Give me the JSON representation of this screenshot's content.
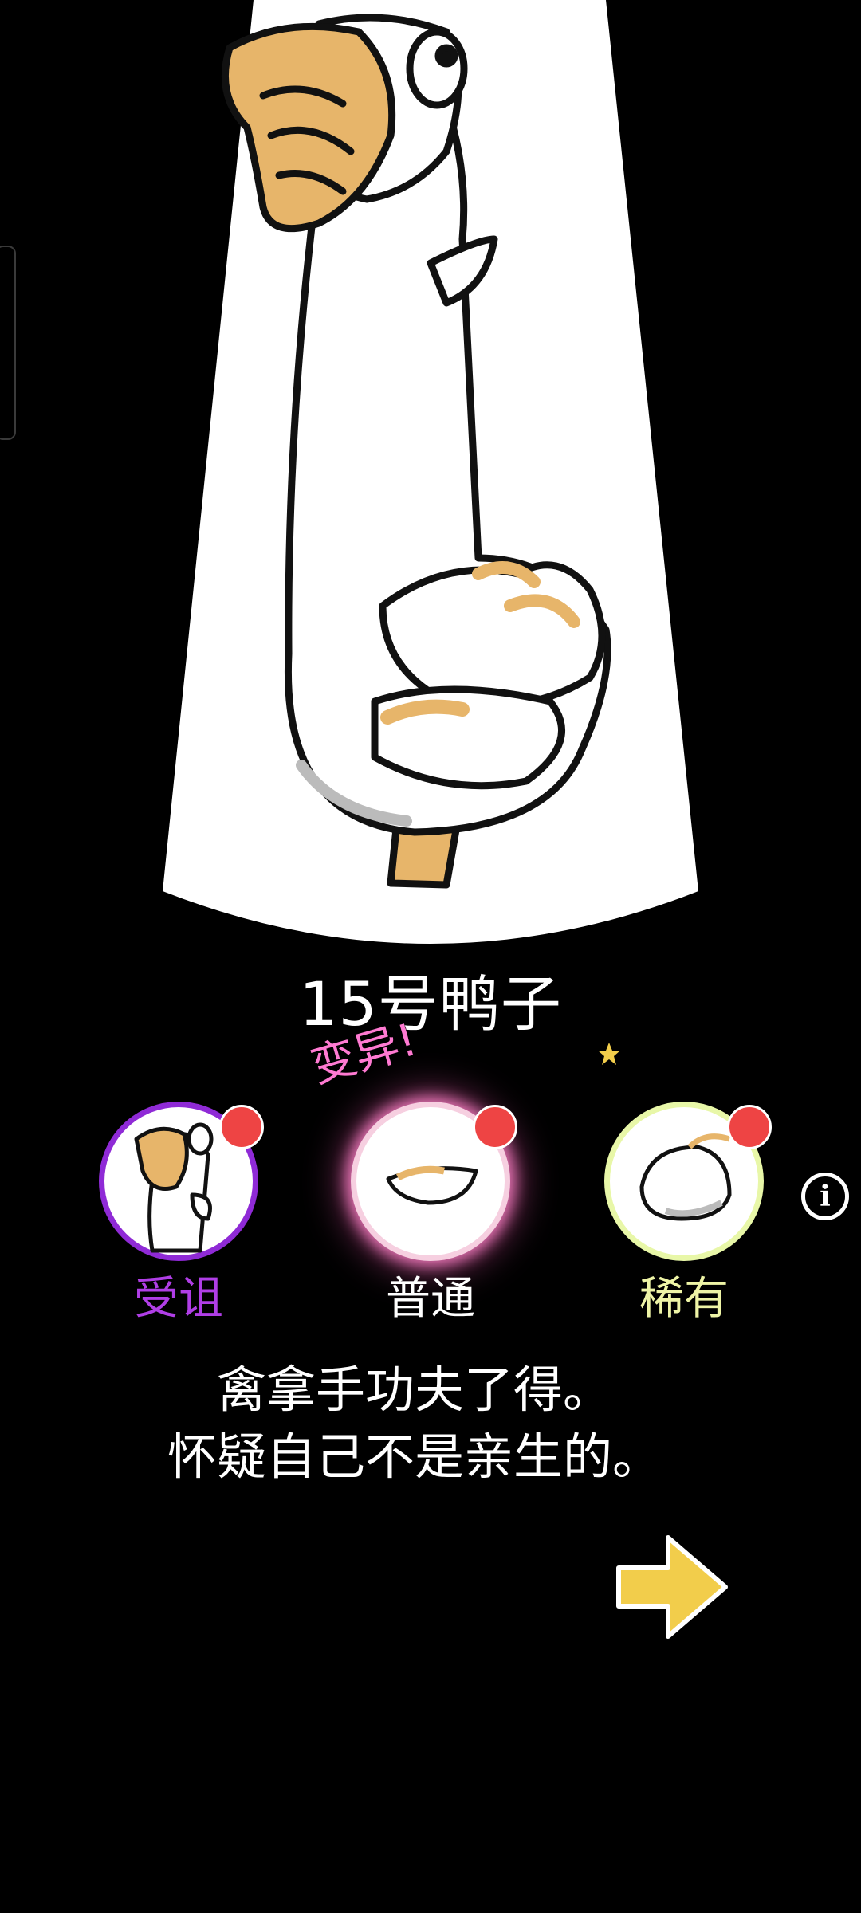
{
  "duck": {
    "name": "15号鸭子",
    "description_line1": "禽拿手功夫了得。",
    "description_line2": "怀疑自己不是亲生的。"
  },
  "variants": {
    "mutation_tag": "变异!",
    "items": [
      {
        "label": "受诅",
        "color": "#b03ee6",
        "has_notification": true
      },
      {
        "label": "普通",
        "color": "#ffffff",
        "has_notification": true,
        "selected": true
      },
      {
        "label": "稀有",
        "color": "#eef4a6",
        "has_notification": true
      }
    ]
  },
  "icons": {
    "info": "i",
    "next": "arrow-right-icon",
    "star": "star-icon"
  },
  "colors": {
    "background": "#000000",
    "spotlight": "#ffffff",
    "arrow": "#f2cd4b",
    "notification_dot": "#ee4444",
    "beak": "#e7b56a"
  }
}
